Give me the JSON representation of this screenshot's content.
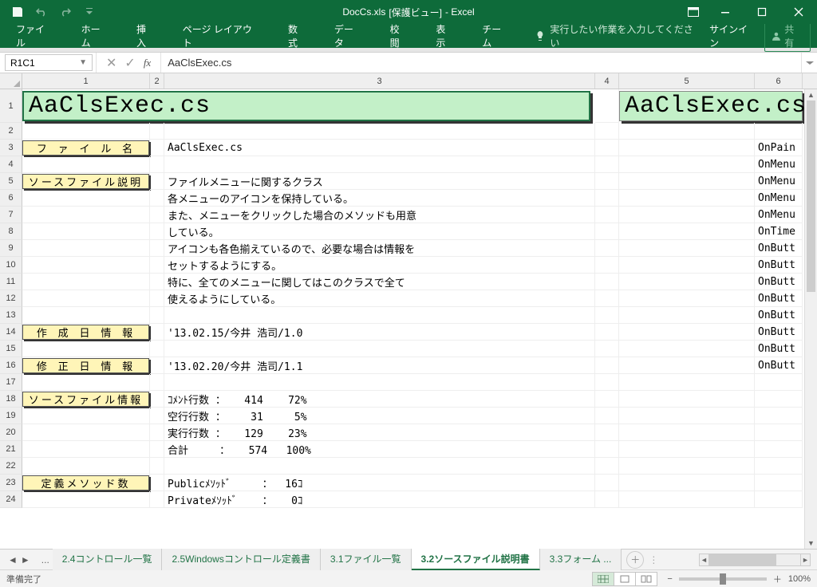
{
  "titlebar": {
    "filename": "DocCs.xls",
    "mode": "[保護ビュー]",
    "app": "- Excel"
  },
  "ribbon": {
    "tabs": [
      "ファイル",
      "ホーム",
      "挿入",
      "ページ レイアウト",
      "数式",
      "データ",
      "校閲",
      "表示",
      "チーム"
    ],
    "tell_placeholder": "実行したい作業を入力してください",
    "signin": "サインイン",
    "share": "共有"
  },
  "namebox": "R1C1",
  "formula": "AaClsExec.cs",
  "columns": [
    "1",
    "2",
    "3",
    "4",
    "5",
    "6"
  ],
  "rows": [
    {
      "n": "1",
      "big": true,
      "banner_left": "AaClsExec.cs",
      "banner_right": "AaClsExec.cs"
    },
    {
      "n": "2"
    },
    {
      "n": "3",
      "label": "フ ァ イ ル 名",
      "c3": "AaClsExec.cs",
      "c6": "OnPain"
    },
    {
      "n": "4",
      "c6": "OnMenu"
    },
    {
      "n": "5",
      "label": "ソースファイル説明",
      "c3": "ファイルメニューに関するクラス",
      "c6": "OnMenu"
    },
    {
      "n": "6",
      "c3": "各メニューのアイコンを保持している。",
      "c6": "OnMenu"
    },
    {
      "n": "7",
      "c3": "また、メニューをクリックした場合のメソッドも用意",
      "c6": "OnMenu"
    },
    {
      "n": "8",
      "c3": "している。",
      "c6": "OnTime"
    },
    {
      "n": "9",
      "c3": "アイコンも各色揃えているので、必要な場合は情報を",
      "c6": "OnButt"
    },
    {
      "n": "10",
      "c3": "セットするようにする。",
      "c6": "OnButt"
    },
    {
      "n": "11",
      "c3": "特に、全てのメニューに関してはこのクラスで全て",
      "c6": "OnButt"
    },
    {
      "n": "12",
      "c3": "使えるようにしている。",
      "c6": "OnButt"
    },
    {
      "n": "13",
      "c6": "OnButt"
    },
    {
      "n": "14",
      "label": "作 成 日 情 報",
      "c3": "'13.02.15/今井 浩司/1.0",
      "c6": "OnButt"
    },
    {
      "n": "15",
      "c6": "OnButt"
    },
    {
      "n": "16",
      "label": "修 正 日 情 報",
      "c3": "'13.02.20/今井 浩司/1.1",
      "c6": "OnButt"
    },
    {
      "n": "17"
    },
    {
      "n": "18",
      "label": "ソースファイル情報",
      "c3": "ｺﾒﾝﾄ行数 ：   414    72%"
    },
    {
      "n": "19",
      "c3": "空行行数 ：    31     5%"
    },
    {
      "n": "20",
      "c3": "実行行数 ：   129    23%"
    },
    {
      "n": "21",
      "c3": "合計     ：   574   100%"
    },
    {
      "n": "22"
    },
    {
      "n": "23",
      "label": "定義メソッド数",
      "c3": "Publicﾒｿｯﾄﾞ     ：  16ｺ"
    },
    {
      "n": "24",
      "c3": "Privateﾒｿｯﾄﾞ    ：   0ｺ"
    }
  ],
  "sheets": {
    "list": [
      "2.4コントロール一覧",
      "2.5Windowsコントロール定義書",
      "3.1ファイル一覧",
      "3.2ソースファイル説明書",
      "3.3フォーム ..."
    ],
    "active_index": 3
  },
  "status": {
    "ready": "準備完了",
    "zoom": "100%"
  }
}
